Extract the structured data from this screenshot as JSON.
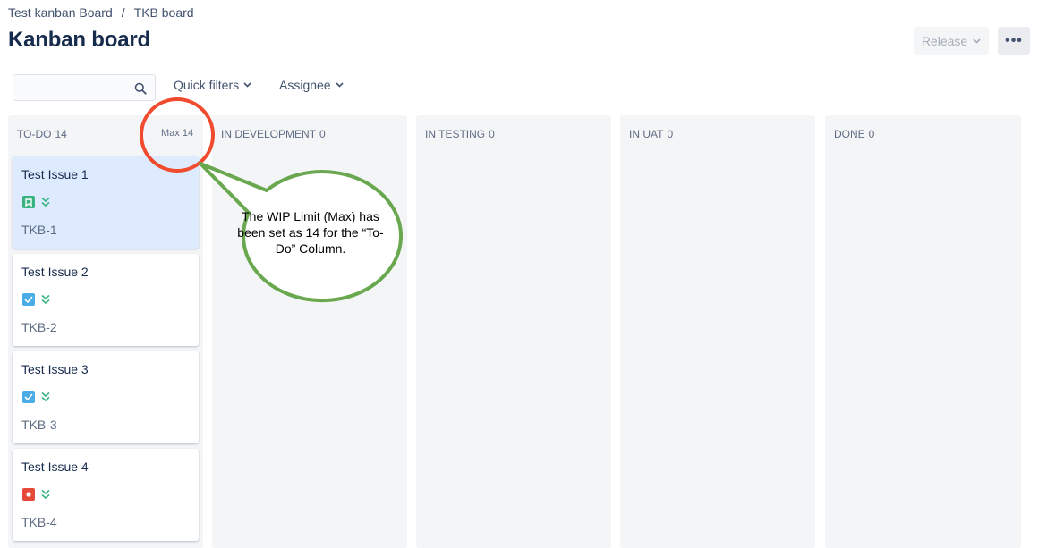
{
  "breadcrumb": {
    "project": "Test kanban Board",
    "separator": "/",
    "board": "TKB board"
  },
  "page": {
    "title": "Kanban board"
  },
  "toolbar": {
    "release_label": "Release",
    "more_label": "•••"
  },
  "search": {
    "placeholder": "",
    "value": ""
  },
  "filters": {
    "quick_filters": "Quick filters",
    "assignee": "Assignee"
  },
  "columns": [
    {
      "name": "TO-DO",
      "count": "14",
      "max": "Max 14"
    },
    {
      "name": "IN DEVELOPMENT",
      "count": "0"
    },
    {
      "name": "IN TESTING",
      "count": "0"
    },
    {
      "name": "IN UAT",
      "count": "0"
    },
    {
      "name": "DONE",
      "count": "0"
    }
  ],
  "cards": [
    {
      "title": "Test Issue 1",
      "key": "TKB-1",
      "type_icon": "story-icon",
      "type_color": "#36b37e",
      "priority_icon": "priority-lowest-icon",
      "selected": true
    },
    {
      "title": "Test Issue 2",
      "key": "TKB-2",
      "type_icon": "task-icon",
      "type_color": "#4bade8",
      "priority_icon": "priority-lowest-icon"
    },
    {
      "title": "Test Issue 3",
      "key": "TKB-3",
      "type_icon": "task-icon",
      "type_color": "#4bade8",
      "priority_icon": "priority-lowest-icon"
    },
    {
      "title": "Test Issue 4",
      "key": "TKB-4",
      "type_icon": "bug-icon",
      "type_color": "#e5493a",
      "priority_icon": "priority-lowest-icon"
    }
  ],
  "annotation": {
    "text": "The WIP Limit (Max) has been set as 14 for the “To-Do” Column.",
    "circle_color": "#f04a2f",
    "bubble_color": "#6aa84f"
  }
}
